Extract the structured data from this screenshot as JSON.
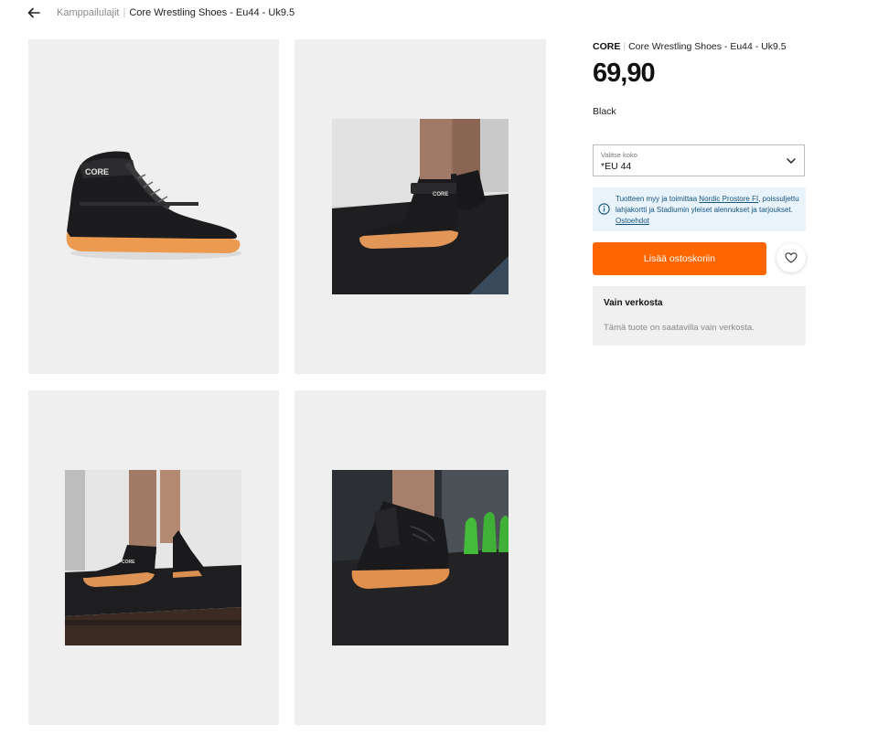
{
  "breadcrumb": {
    "parent": "Kamppailulajit",
    "current": "Core Wrestling Shoes - Eu44 - Uk9.5"
  },
  "product": {
    "brand": "CORE",
    "title": "Core Wrestling Shoes - Eu44 - Uk9.5",
    "price": "69,90",
    "color": "Black"
  },
  "size_select": {
    "label": "Valitse koko",
    "value": "*EU 44"
  },
  "info_box": {
    "text_before": "Tuotteen myy ja toimittaa ",
    "seller_link": "Nordic Prostore FI",
    "text_after": ", poissuljettu lahjakortti ja Stadiumin yleiset alennukset ja tarjoukset. ",
    "terms_link": "Ostoehdot"
  },
  "add_to_cart": {
    "label": "Lisää ostoskoriin"
  },
  "online_only": {
    "title": "Vain verkosta",
    "description": "Tämä tuote on saatavilla vain verkosta."
  },
  "images": [
    {
      "logo": "CORE"
    },
    {
      "logo": "CORE"
    },
    {
      "logo": "CORE"
    },
    {
      "logo": ""
    }
  ],
  "colors": {
    "accent_orange": "#ff6600",
    "info_bg": "#e8f3fc",
    "info_text": "#17557f",
    "tile_bg": "#efefef"
  },
  "icons": {
    "back": "arrow-left-icon",
    "chevron": "chevron-down-icon",
    "info": "info-circle-icon",
    "wishlist": "heart-icon"
  }
}
